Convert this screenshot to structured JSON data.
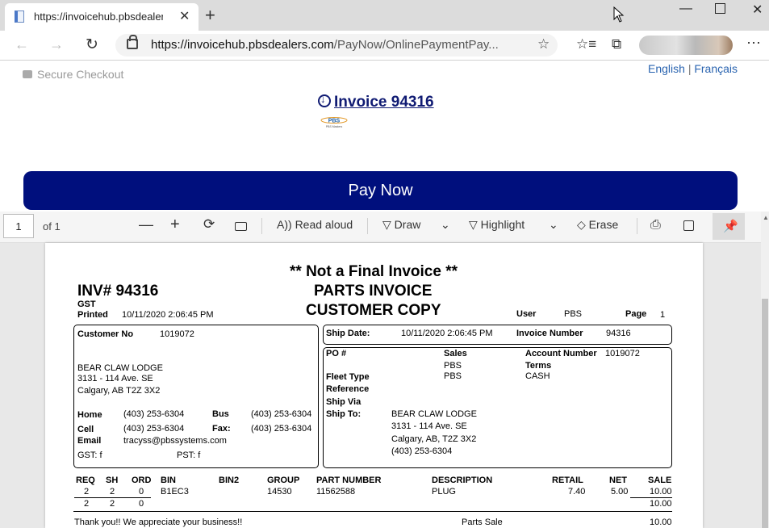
{
  "browser": {
    "tab_title": "https://invoicehub.pbsdealers.co",
    "url_domain": "https://invoicehub.pbsdealers.com",
    "url_path": "/PayNow/OnlinePaymentPay..."
  },
  "page": {
    "secure_checkout": "Secure Checkout",
    "lang_english": "English",
    "lang_separator": "|",
    "lang_french": "Français",
    "invoice_link": "Invoice 94316",
    "logo_text": "PBS",
    "logo_subtext": "PBS Masters",
    "pay_now": "Pay Now"
  },
  "pdf_toolbar": {
    "page_number": "1",
    "of_pages": "of 1",
    "read_aloud": "Read aloud",
    "draw": "Draw",
    "highlight": "Highlight",
    "erase": "Erase"
  },
  "invoice": {
    "not_final": "** Not a Final Invoice **",
    "parts_invoice": "PARTS INVOICE",
    "customer_copy": "CUSTOMER COPY",
    "inv_no": "INV# 94316",
    "gst": "GST",
    "printed_label": "Printed",
    "printed_value": "10/11/2020 2:06:45 PM",
    "user_label": "User",
    "user_value": "PBS",
    "page_label": "Page",
    "page_value": "1",
    "customer_no_label": "Customer No",
    "customer_no_value": "1019072",
    "customer_name": "BEAR CLAW LODGE",
    "customer_addr1": "3131 - 114 Ave. SE",
    "customer_addr2": "Calgary, AB T2Z 3X2",
    "home_label": "Home",
    "home_value": "(403) 253-6304",
    "bus_label": "Bus",
    "bus_value": "(403) 253-6304",
    "cell_label": "Cell",
    "cell_value": "(403) 253-6304",
    "fax_label": "Fax:",
    "fax_value": "(403) 253-6304",
    "email_label": "Email",
    "email_value": "tracyss@pbssystems.com",
    "gst_f": "GST: f",
    "pst_f": "PST: f",
    "ship_date_label": "Ship Date:",
    "ship_date_value": "10/11/2020 2:06:45 PM",
    "invoice_number_label": "Invoice Number",
    "invoice_number_value": "94316",
    "po_label": "PO #",
    "sales_label": "Sales",
    "sales_value1": "PBS",
    "sales_value2": "PBS",
    "account_number_label": "Account Number",
    "account_number_value": "1019072",
    "terms_label": "Terms",
    "terms_value": "CASH",
    "fleet_type_label": "Fleet Type",
    "reference_label": "Reference",
    "ship_via_label": "Ship Via",
    "ship_to_label": "Ship To:",
    "ship_to_name": "BEAR CLAW LODGE",
    "ship_to_addr1": "3131 - 114 Ave. SE",
    "ship_to_addr2": "Calgary, AB, T2Z 3X2",
    "ship_to_phone": "(403) 253-6304",
    "columns": {
      "req": "REQ",
      "sh": "SH",
      "ord": "ORD",
      "bin": "BIN",
      "bin2": "BIN2",
      "group": "GROUP",
      "part_number": "PART NUMBER",
      "description": "DESCRIPTION",
      "retail": "RETAIL",
      "net": "NET",
      "sale": "SALE"
    },
    "line": {
      "req": "2",
      "sh": "2",
      "ord": "0",
      "bin": "B1EC3",
      "group": "14530",
      "part_number": "11562588",
      "description": "PLUG",
      "retail": "7.40",
      "net": "5.00",
      "sale": "10.00"
    },
    "totals": {
      "req": "2",
      "sh": "2",
      "ord": "0",
      "sale": "10.00"
    },
    "thank_you": "Thank you!!  We appreciate your business!!",
    "parts_sale_label": "Parts Sale",
    "parts_sale_value": "10.00"
  }
}
